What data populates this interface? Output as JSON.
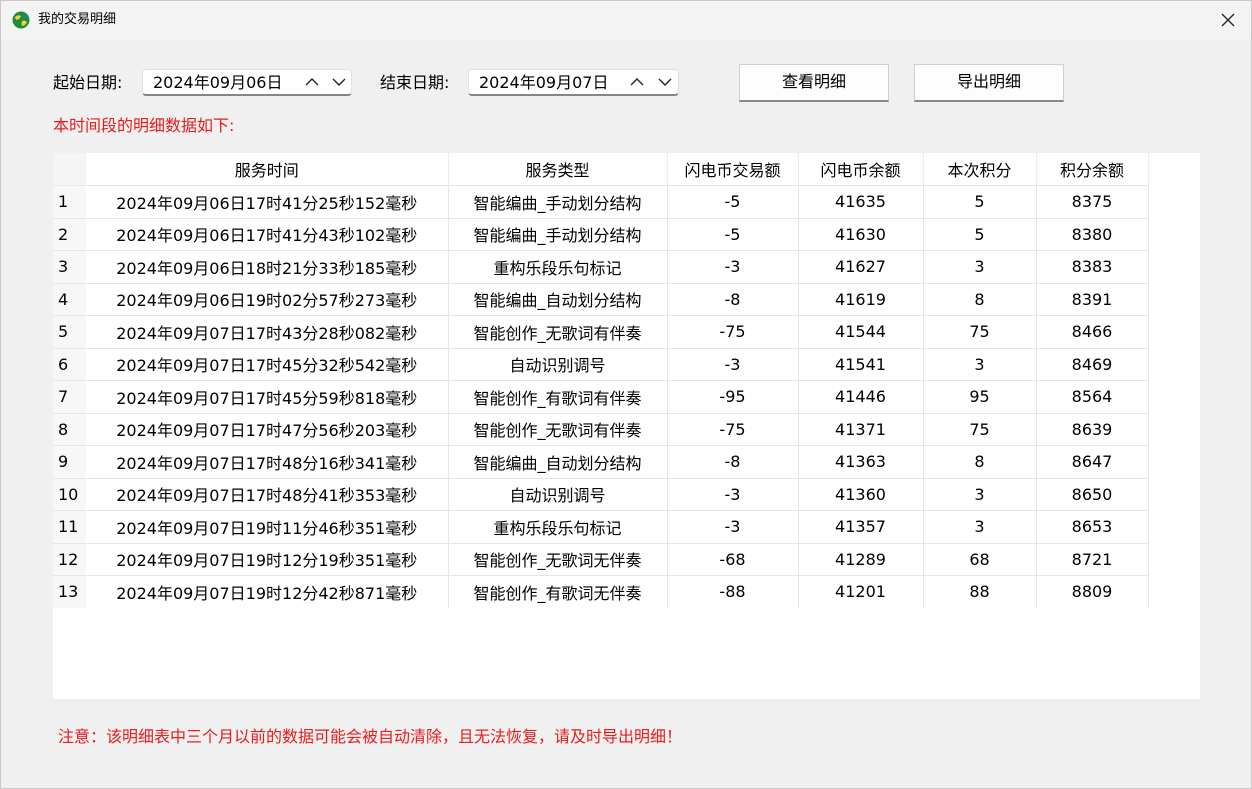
{
  "window": {
    "title": "我的交易明细"
  },
  "filters": {
    "start_label": "起始日期:",
    "start_value": "2024年09月06日",
    "end_label": "结束日期:",
    "end_value": "2024年09月07日",
    "view_button": "查看明细",
    "export_button": "导出明细"
  },
  "notice_top": "本时间段的明细数据如下:",
  "notice_bottom": "注意：该明细表中三个月以前的数据可能会被自动清除，且无法恢复，请及时导出明细！",
  "table": {
    "columns": [
      "服务时间",
      "服务类型",
      "闪电币交易额",
      "闪电币余额",
      "本次积分",
      "积分余额"
    ],
    "rows": [
      {
        "no": "1",
        "time": "2024年09月06日17时41分25秒152毫秒",
        "type": "智能编曲_手动划分结构",
        "amount": "-5",
        "balance": "41635",
        "points": "5",
        "points_balance": "8375"
      },
      {
        "no": "2",
        "time": "2024年09月06日17时41分43秒102毫秒",
        "type": "智能编曲_手动划分结构",
        "amount": "-5",
        "balance": "41630",
        "points": "5",
        "points_balance": "8380"
      },
      {
        "no": "3",
        "time": "2024年09月06日18时21分33秒185毫秒",
        "type": "重构乐段乐句标记",
        "amount": "-3",
        "balance": "41627",
        "points": "3",
        "points_balance": "8383"
      },
      {
        "no": "4",
        "time": "2024年09月06日19时02分57秒273毫秒",
        "type": "智能编曲_自动划分结构",
        "amount": "-8",
        "balance": "41619",
        "points": "8",
        "points_balance": "8391"
      },
      {
        "no": "5",
        "time": "2024年09月07日17时43分28秒082毫秒",
        "type": "智能创作_无歌词有伴奏",
        "amount": "-75",
        "balance": "41544",
        "points": "75",
        "points_balance": "8466"
      },
      {
        "no": "6",
        "time": "2024年09月07日17时45分32秒542毫秒",
        "type": "自动识别调号",
        "amount": "-3",
        "balance": "41541",
        "points": "3",
        "points_balance": "8469"
      },
      {
        "no": "7",
        "time": "2024年09月07日17时45分59秒818毫秒",
        "type": "智能创作_有歌词有伴奏",
        "amount": "-95",
        "balance": "41446",
        "points": "95",
        "points_balance": "8564"
      },
      {
        "no": "8",
        "time": "2024年09月07日17时47分56秒203毫秒",
        "type": "智能创作_无歌词有伴奏",
        "amount": "-75",
        "balance": "41371",
        "points": "75",
        "points_balance": "8639"
      },
      {
        "no": "9",
        "time": "2024年09月07日17时48分16秒341毫秒",
        "type": "智能编曲_自动划分结构",
        "amount": "-8",
        "balance": "41363",
        "points": "8",
        "points_balance": "8647"
      },
      {
        "no": "10",
        "time": "2024年09月07日17时48分41秒353毫秒",
        "type": "自动识别调号",
        "amount": "-3",
        "balance": "41360",
        "points": "3",
        "points_balance": "8650"
      },
      {
        "no": "11",
        "time": "2024年09月07日19时11分46秒351毫秒",
        "type": "重构乐段乐句标记",
        "amount": "-3",
        "balance": "41357",
        "points": "3",
        "points_balance": "8653"
      },
      {
        "no": "12",
        "time": "2024年09月07日19时12分19秒351毫秒",
        "type": "智能创作_无歌词无伴奏",
        "amount": "-68",
        "balance": "41289",
        "points": "68",
        "points_balance": "8721"
      },
      {
        "no": "13",
        "time": "2024年09月07日19时12分42秒871毫秒",
        "type": "智能创作_有歌词无伴奏",
        "amount": "-88",
        "balance": "41201",
        "points": "88",
        "points_balance": "8809"
      }
    ]
  },
  "colors": {
    "notice": "#e81c1c",
    "window_bg": "#f0f0f0"
  },
  "icons": {
    "app": "globe-icon",
    "close": "close-icon",
    "spin_up": "chevron-up-icon",
    "spin_down": "chevron-down-icon"
  }
}
